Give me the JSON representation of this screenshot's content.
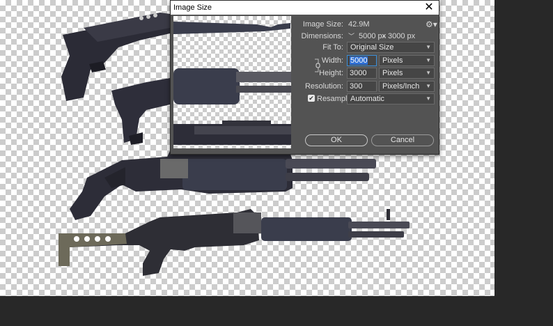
{
  "dialog": {
    "title": "Image Size",
    "close_glyph": "✕",
    "settings_icon": "gear-icon",
    "image_size": {
      "label": "Image Size:",
      "value": "42.9M"
    },
    "dimensions": {
      "label": "Dimensions:",
      "width": "5000 px",
      "times": "×",
      "height": "3000 px"
    },
    "fit_to": {
      "label": "Fit To:",
      "value": "Original Size"
    },
    "width": {
      "label": "Width:",
      "value": "5000",
      "unit": "Pixels"
    },
    "height": {
      "label": "Height:",
      "value": "3000",
      "unit": "Pixels"
    },
    "resolution": {
      "label": "Resolution:",
      "value": "300",
      "unit": "Pixels/Inch"
    },
    "resample": {
      "label": "Resample:",
      "checked": true,
      "value": "Automatic"
    },
    "ok_label": "OK",
    "cancel_label": "Cancel"
  },
  "colors": {
    "dialog_bg": "#535353",
    "workspace_bg": "#282828",
    "selection": "#2f6fd1"
  }
}
